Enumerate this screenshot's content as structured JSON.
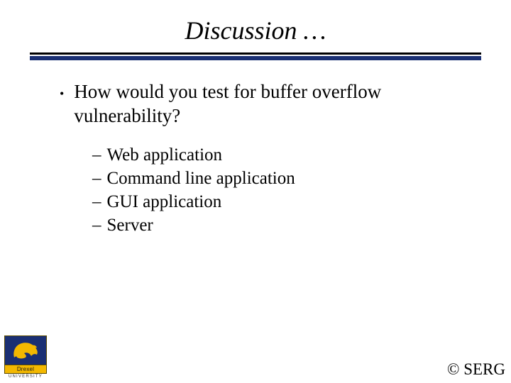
{
  "title": "Discussion …",
  "bullet": {
    "text": "How would you test for buffer overflow vulnerability?",
    "subitems": [
      "Web application",
      "Command line application",
      "GUI application",
      "Server"
    ]
  },
  "logo": {
    "name": "Drexel",
    "subtitle": "UNIVERSITY"
  },
  "copyright": "© SERG"
}
